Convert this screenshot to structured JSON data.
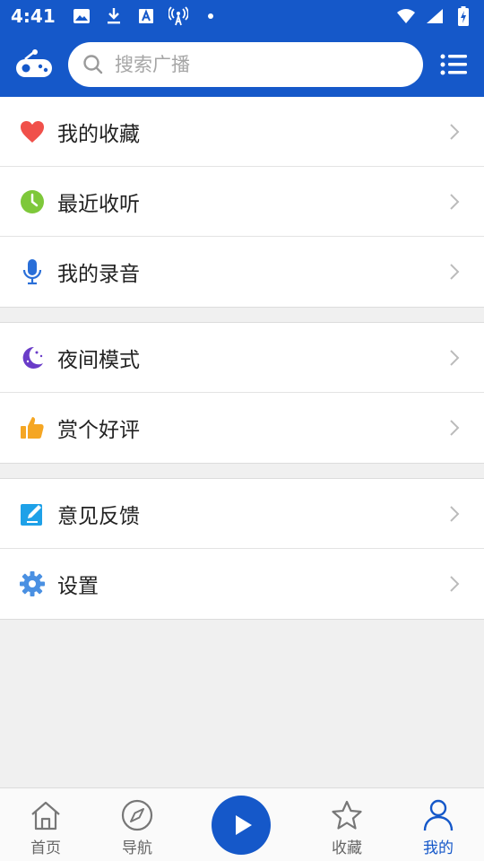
{
  "status_bar": {
    "time": "4:41",
    "left_icons": [
      "image-icon",
      "download-icon",
      "text-icon",
      "antenna-icon",
      "dot-icon"
    ],
    "right_icons": [
      "wifi-icon",
      "signal-icon",
      "battery-icon"
    ]
  },
  "header": {
    "logo_icon": "radio-logo-icon",
    "search_placeholder": "搜索广播",
    "menu_icon": "list-menu-icon"
  },
  "groups": [
    {
      "items": [
        {
          "label": "我的收藏",
          "icon": "heart-icon",
          "color": "#f0504a"
        },
        {
          "label": "最近收听",
          "icon": "clock-icon",
          "color": "#7ec83a"
        },
        {
          "label": "我的录音",
          "icon": "microphone-icon",
          "color": "#2a6fd8"
        }
      ]
    },
    {
      "items": [
        {
          "label": "夜间模式",
          "icon": "moon-icon",
          "color": "#6a3cc8"
        },
        {
          "label": "赏个好评",
          "icon": "thumbs-up-icon",
          "color": "#f5a623"
        }
      ]
    },
    {
      "items": [
        {
          "label": "意见反馈",
          "icon": "edit-icon",
          "color": "#1ea1e8"
        },
        {
          "label": "设置",
          "icon": "gear-icon",
          "color": "#4a90e2"
        }
      ]
    }
  ],
  "bottom_nav": {
    "items": [
      {
        "label": "首页",
        "icon": "home-icon",
        "active": false
      },
      {
        "label": "导航",
        "icon": "compass-icon",
        "active": false
      },
      {
        "label": "收藏",
        "icon": "star-icon",
        "active": false
      },
      {
        "label": "我的",
        "icon": "user-icon",
        "active": true
      }
    ],
    "play_icon": "play-icon"
  },
  "colors": {
    "primary": "#1558c9",
    "inactive": "#666666",
    "chevron": "#bbbbbb"
  }
}
